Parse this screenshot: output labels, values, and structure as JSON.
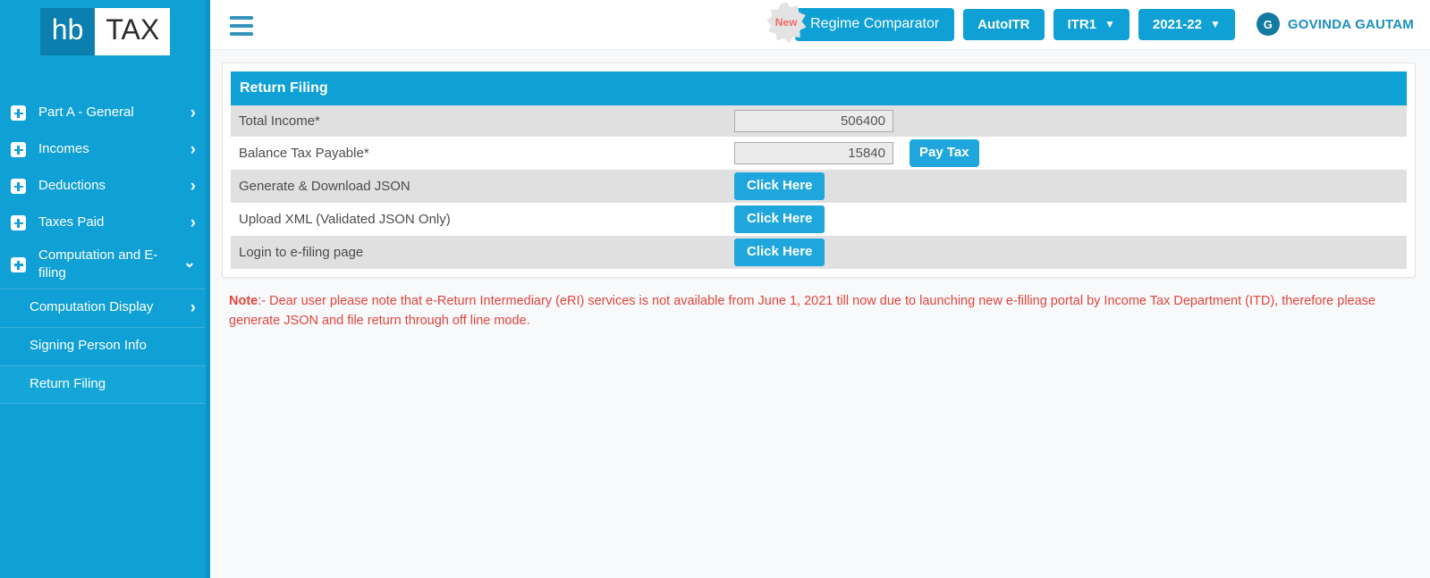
{
  "brand": {
    "logo_left": "hb",
    "logo_right": "TAX"
  },
  "colors": {
    "sidebar_bg": "#0fa0d5",
    "accent_blue": "#0fa0d5",
    "button_blue": "#1fa7dd",
    "note_red": "#e0453e",
    "row_striped": "#e0e0e0",
    "avatar_bg": "#127ba0",
    "user_name": "#1a8fc1",
    "new_badge_text": "#ef6a6a"
  },
  "sidebar": {
    "items": [
      {
        "label": "Part A - General",
        "icon": "plus-box-icon",
        "chevron": "chevron-right-icon",
        "expanded": false
      },
      {
        "label": "Incomes",
        "icon": "plus-box-icon",
        "chevron": "chevron-right-icon",
        "expanded": false
      },
      {
        "label": "Deductions",
        "icon": "plus-box-icon",
        "chevron": "chevron-right-icon",
        "expanded": false
      },
      {
        "label": "Taxes Paid",
        "icon": "plus-box-icon",
        "chevron": "chevron-right-icon",
        "expanded": false
      },
      {
        "label": "Computation and E-filing",
        "icon": "plus-box-icon",
        "chevron": "chevron-down-icon",
        "expanded": true
      }
    ],
    "subitems": [
      {
        "label": "Computation Display",
        "chevron": "chevron-right-icon",
        "active": false
      },
      {
        "label": "Signing Person Info",
        "chevron": "",
        "active": false
      },
      {
        "label": "Return Filing",
        "chevron": "",
        "active": true
      }
    ]
  },
  "topbar": {
    "menu_icon": "hamburger-icon",
    "new_badge": "New",
    "regime_comparator": "Regime Comparator",
    "auto_itr": "AutoITR",
    "itr_form": "ITR1",
    "assessment_year": "2021-22",
    "caret_icon": "chevron-down-icon",
    "avatar_initial": "G",
    "user_name": "GOVINDA GAUTAM"
  },
  "card": {
    "title": "Return Filing",
    "rows": [
      {
        "label": "Total Income*",
        "type": "input",
        "value": "506400",
        "placeholder": "",
        "button": ""
      },
      {
        "label": "Balance Tax Payable*",
        "type": "input",
        "value": "15840",
        "placeholder": "",
        "button": "Pay Tax"
      },
      {
        "label": "Generate & Download JSON",
        "type": "button",
        "value": "",
        "placeholder": "",
        "button": "Click Here"
      },
      {
        "label": "Upload XML (Validated JSON Only)",
        "type": "button",
        "value": "",
        "placeholder": "",
        "button": "Click Here"
      },
      {
        "label": "Login to e-filing page",
        "type": "button",
        "value": "",
        "placeholder": "",
        "button": "Click Here"
      }
    ]
  },
  "note": {
    "prefix": "Note",
    "body": ":- Dear user please note that e-Return Intermediary (eRI) services is not available from June 1, 2021 till now due to launching new e-filling portal by Income Tax Department (ITD), therefore please generate JSON and file return through off line mode."
  }
}
